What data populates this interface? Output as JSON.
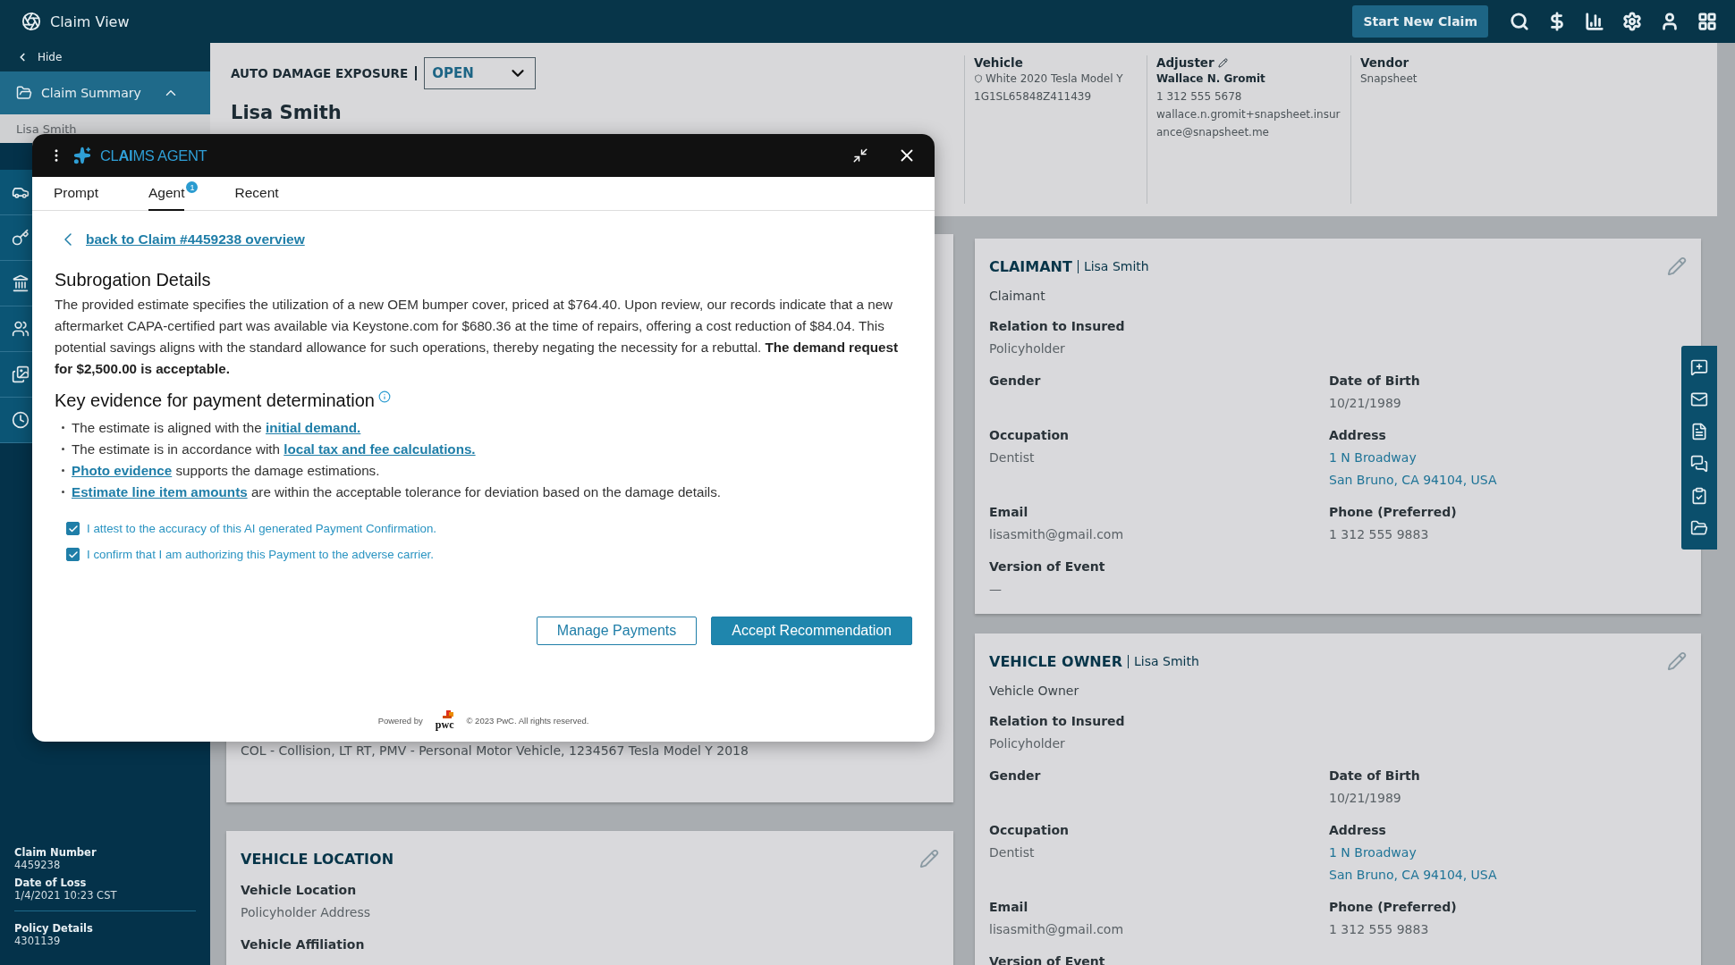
{
  "app_bar": {
    "title": "Claim View",
    "button": "Start New Claim"
  },
  "sidebar": {
    "hide": "Hide",
    "section": {
      "label": "Claim Summary",
      "expanded": true
    },
    "items": [
      {
        "label": "Lisa Smith",
        "selected": true
      }
    ],
    "claim_info": [
      {
        "label": "Claim Number",
        "value": "4459238"
      },
      {
        "label": "Date of Loss",
        "value": "1/4/2021 10:23 CST"
      },
      {
        "label": "Policy Details",
        "value": "4301139"
      }
    ]
  },
  "header": {
    "exposure": "AUTO DAMAGE EXPOSURE",
    "status": "OPEN",
    "name": "Lisa Smith",
    "info": [
      {
        "kind": "vehicle",
        "label": "Vehicle",
        "lines": [
          "White 2020 Tesla Model Y",
          "1G1SL65848Z411439"
        ]
      },
      {
        "kind": "adjuster",
        "label": "Adjuster",
        "lines": [
          "Wallace N. Gromit",
          "1 312 555 5678",
          "wallace.n.gromit+snapsheet.insurance@snapsheet.me"
        ]
      },
      {
        "kind": "vendor",
        "label": "Vendor",
        "lines": [
          "Snapsheet"
        ]
      }
    ]
  },
  "left_cards": [
    {
      "lines": [
        "COL - Collision, LT RT, PMV - Personal Motor Vehicle, 1234567 Tesla Model Y 2018"
      ]
    },
    {
      "title": "VEHICLE LOCATION",
      "fields": [
        {
          "label": "Vehicle Location",
          "lines": [
            "Policyholder Address"
          ],
          "wide": true,
          "link": false
        },
        {
          "label": "Vehicle Affiliation",
          "wide": true
        }
      ]
    }
  ],
  "right_cards": [
    {
      "title": "CLAIMANT",
      "name": "Lisa Smith",
      "role": "Claimant",
      "fields": [
        {
          "label": "Relation to Insured",
          "lines": [
            "Policyholder"
          ],
          "wide": true,
          "link": false
        },
        {
          "label": "Gender",
          "wide": false
        },
        {
          "label": "Date of Birth",
          "lines": [
            "10/21/1989"
          ],
          "wide": false,
          "link": false
        },
        {
          "label": "Occupation",
          "lines": [
            "Dentist"
          ],
          "wide": false,
          "link": false
        },
        {
          "label": "Address",
          "lines": [
            "1 N Broadway",
            "San Bruno, CA 94104, USA"
          ],
          "wide": false,
          "link": true
        },
        {
          "label": "Email",
          "lines": [
            "lisasmith@gmail.com"
          ],
          "wide": false,
          "link": false
        },
        {
          "label": "Phone (Preferred)",
          "lines": [
            "1 312 555 9883"
          ],
          "wide": false,
          "link": false
        },
        {
          "label": "Version of Event",
          "lines": [
            "—"
          ],
          "wide": true,
          "link": false
        }
      ]
    },
    {
      "title": "VEHICLE OWNER",
      "name": "Lisa Smith",
      "role": "Vehicle Owner",
      "fields": [
        {
          "label": "Relation to Insured",
          "lines": [
            "Policyholder"
          ],
          "wide": true,
          "link": false
        },
        {
          "label": "Gender",
          "wide": false
        },
        {
          "label": "Date of Birth",
          "lines": [
            "10/21/1989"
          ],
          "wide": false,
          "link": false
        },
        {
          "label": "Occupation",
          "lines": [
            "Dentist"
          ],
          "wide": false,
          "link": false
        },
        {
          "label": "Address",
          "lines": [
            "1 N Broadway",
            "San Bruno, CA 94104, USA"
          ],
          "wide": false,
          "link": true
        },
        {
          "label": "Email",
          "lines": [
            "lisasmith@gmail.com"
          ],
          "wide": false,
          "link": false
        },
        {
          "label": "Phone (Preferred)",
          "lines": [
            "1 312 555 9883"
          ],
          "wide": false,
          "link": false
        },
        {
          "label": "Version of Event",
          "wide": true
        }
      ]
    }
  ],
  "agent": {
    "title": "CL**AI**MS AGENT",
    "tabs": [
      {
        "label": "Prompt",
        "selected": false
      },
      {
        "label": "Agent",
        "selected": true,
        "badge": "1"
      },
      {
        "label": "Recent",
        "selected": false
      }
    ],
    "back_link": "back to Claim #4459238 overview",
    "heading": "Subrogation Details",
    "paragraph": "The provided estimate specifies the utilization of a new OEM bumper cover, priced at $764.40. Upon review, our records indicate that a new aftermarket CAPA-certified part was available via Keystone.com for $680.36 at the time of repairs, offering a cost reduction of $84.04. This potential savings aligns with the standard allowance for such operations, thereby negating the necessity for a rebuttal. **The demand request for $2,500.00 is acceptable.**",
    "evidence_heading": "Key evidence for payment determination",
    "evidence": [
      {
        "before": "The estimate is aligned with the ",
        "link": "initial demand."
      },
      {
        "before": "The estimate is in accordance with ",
        "link": "local tax and fee calculations."
      },
      {
        "link": "Photo evidence",
        "after": " supports the damage estimations."
      },
      {
        "link": "Estimate line item amounts",
        "after": " are within the acceptable tolerance for deviation based on the damage details."
      }
    ],
    "checks": [
      {
        "label": "I attest to the accuracy of this AI generated Payment Confirmation.",
        "checked": true
      },
      {
        "label": "I confirm that I am authorizing this Payment to the adverse carrier.",
        "checked": true
      }
    ],
    "buttons": [
      {
        "label": "Manage Payments",
        "kind": "secondary"
      },
      {
        "label": "Accept Recommendation",
        "kind": "primary"
      }
    ],
    "footer": {
      "powered": "Powered by",
      "logo": "pwc",
      "copyright": "© 2023 PwC. All rights reserved."
    }
  }
}
